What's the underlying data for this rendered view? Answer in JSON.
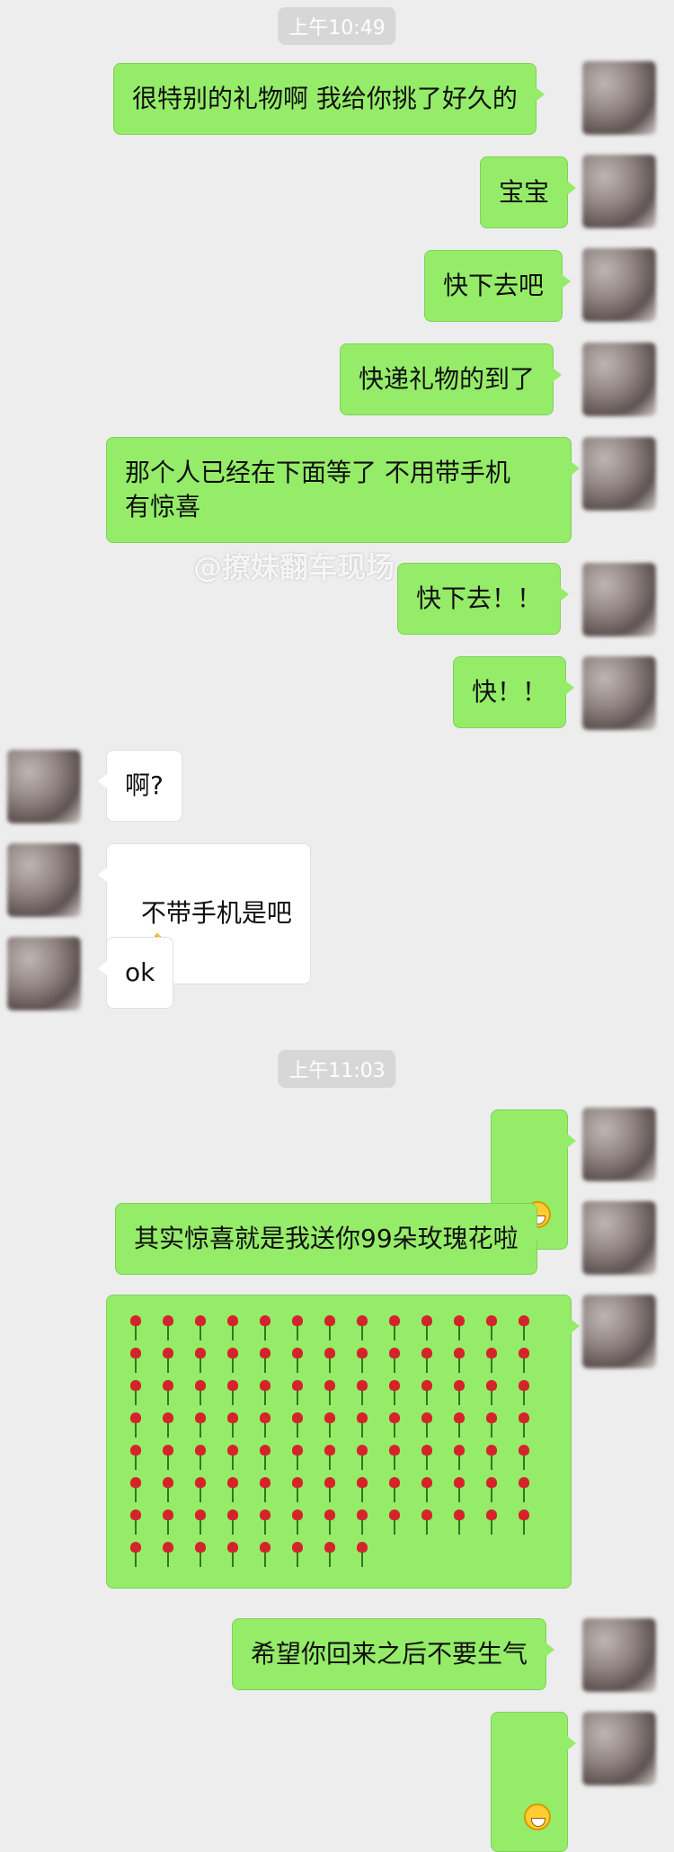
{
  "timestamps": [
    "上午10:49",
    "上午11:03"
  ],
  "messages": [
    {
      "side": "right",
      "text": "很特别的礼物啊 我给你挑了好久的"
    },
    {
      "side": "right",
      "text": "宝宝"
    },
    {
      "side": "right",
      "text": "快下去吧"
    },
    {
      "side": "right",
      "text": "快递礼物的到了"
    },
    {
      "side": "right",
      "text": "那个人已经在下面等了 不用带手机\n有惊喜"
    },
    {
      "side": "right",
      "text": "快下去！！"
    },
    {
      "side": "right",
      "text": "快！！"
    },
    {
      "side": "left",
      "text": "啊?"
    },
    {
      "side": "left",
      "text": "不带手机是吧"
    },
    {
      "side": "left",
      "text": "ok"
    },
    {
      "side": "right",
      "text": ""
    },
    {
      "side": "right",
      "text": "其实惊喜就是我送你99朵玫瑰花啦"
    },
    {
      "side": "right",
      "text": "希望你回来之后不要生气"
    },
    {
      "side": "right",
      "text": ""
    }
  ],
  "watermark": "@撩妹翻车现场",
  "colors": {
    "me_bubble": "#95ec69",
    "them_bubble": "#ffffff",
    "background": "#ededed"
  },
  "icons": {
    "ok": "ok-hand-emoji",
    "grin": "grinning-face-emoji",
    "rose": "rose-emoji"
  },
  "rose_count": 99
}
